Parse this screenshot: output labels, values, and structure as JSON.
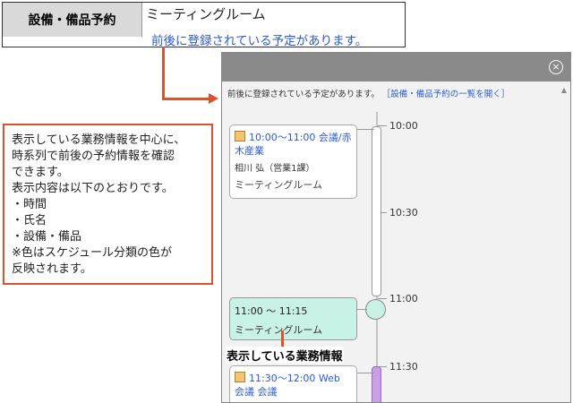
{
  "top_snippet": {
    "label": "設備・備品予約",
    "facility": "ミーティングルーム",
    "message": "前後に登録されている予定があります。"
  },
  "popup": {
    "info_text": "前後に登録されている予定があります。",
    "list_link": "［設備・備品予約の一覧を開く］",
    "times": [
      "10:00",
      "10:30",
      "11:00",
      "11:30"
    ],
    "events": [
      {
        "time_title": "10:00～11:00 会議/赤木産業",
        "person": "相川 弘（営業1課）",
        "facility": "ミーティングルーム",
        "category_color": "#f5c470"
      },
      {
        "time": "11:00 ～ 11:15",
        "facility": "ミーティングルーム",
        "bg_color": "#c8f2e6"
      },
      {
        "time_title": "11:30～12:00 Web 会議 会議",
        "category_color": "#f5c470",
        "bar_color": "#c9a0e6"
      }
    ]
  },
  "callout": {
    "lines": [
      "表示している業務情報を中心に、",
      "時系列で前後の予約情報を確認",
      "できます。",
      "表示内容は以下のとおりです。",
      "・時間",
      "・氏名",
      "・設備・備品",
      "※色はスケジュール分類の色が",
      "反映されます。"
    ]
  },
  "current_label": "表示している業務情報"
}
